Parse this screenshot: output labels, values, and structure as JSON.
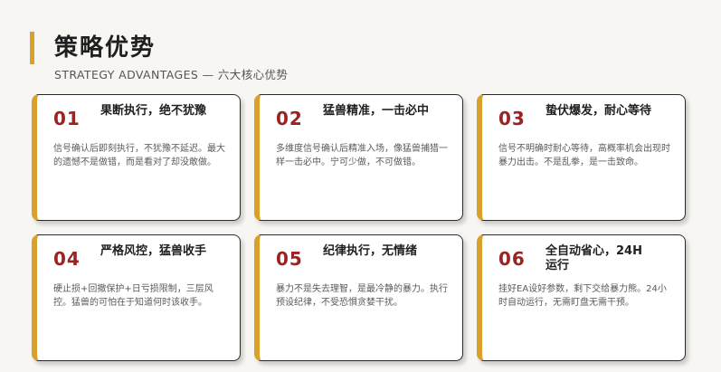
{
  "header": {
    "title": "策略优势",
    "subtitle": "STRATEGY ADVANTAGES — 六大核心优势"
  },
  "cards": [
    {
      "num": "01",
      "title": "果断执行，绝不犹豫",
      "desc": "信号确认后即刻执行，不犹豫不延迟。最大的遗憾不是做错，而是看对了却没敢做。"
    },
    {
      "num": "02",
      "title": "猛兽精准，一击必中",
      "desc": "多维度信号确认后精准入场，像猛兽捕猎一样一击必中。宁可少做，不可做错。"
    },
    {
      "num": "03",
      "title": "蛰伏爆发，耐心等待",
      "desc": "信号不明确时耐心等待，高概率机会出现时暴力出击。不是乱拳，是一击致命。"
    },
    {
      "num": "04",
      "title": "严格风控，猛兽收手",
      "desc": "硬止损+回撤保护+日亏损限制，三层风控。猛兽的可怕在于知道何时该收手。"
    },
    {
      "num": "05",
      "title": "纪律执行，无情绪",
      "desc": "暴力不是失去理智，是最冷静的暴力。执行预设纪律，不受恐惧贪婪干扰。"
    },
    {
      "num": "06",
      "title": "全自动省心，24H运行",
      "desc": "挂好EA设好参数，剩下交给暴力熊。24小时自动运行，无需盯盘无需干预。"
    }
  ],
  "colors": {
    "accent": "#d9a12a",
    "number": "#9a2323"
  }
}
